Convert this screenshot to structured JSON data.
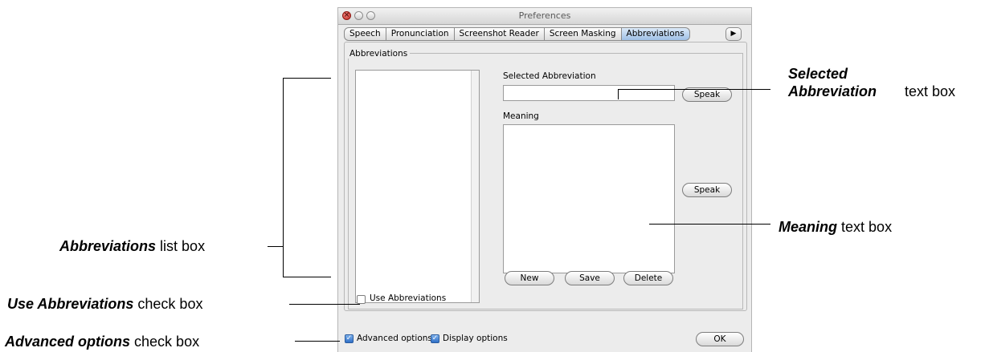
{
  "window": {
    "title": "Preferences"
  },
  "tabs": [
    {
      "label": "Speech"
    },
    {
      "label": "Pronunciation"
    },
    {
      "label": "Screenshot Reader"
    },
    {
      "label": "Screen Masking"
    },
    {
      "label": "Abbreviations",
      "selected": true
    }
  ],
  "tab_scroll_icon": "right-arrow-icon",
  "group": {
    "label": "Abbreviations"
  },
  "selected_abbreviation": {
    "label": "Selected Abbreviation",
    "value": "",
    "speak_label": "Speak"
  },
  "meaning": {
    "label": "Meaning",
    "value": "",
    "speak_label": "Speak"
  },
  "actions": {
    "new_label": "New",
    "save_label": "Save",
    "delete_label": "Delete"
  },
  "use_abbreviations": {
    "label": "Use Abbreviations",
    "checked": false
  },
  "footer": {
    "advanced_label": "Advanced options",
    "advanced_checked": true,
    "display_label": "Display options",
    "display_checked": true,
    "ok_label": "OK"
  },
  "annotations": {
    "selected_bold": "Selected Abbreviation",
    "selected_rest": "text box",
    "meaning_bold": "Meaning",
    "meaning_rest": "text box",
    "list_bold": "Abbreviations",
    "list_rest": "list box",
    "use_bold": "Use Abbreviations",
    "use_rest": "check box",
    "advanced_bold": "Advanced options",
    "advanced_rest": "check box"
  }
}
